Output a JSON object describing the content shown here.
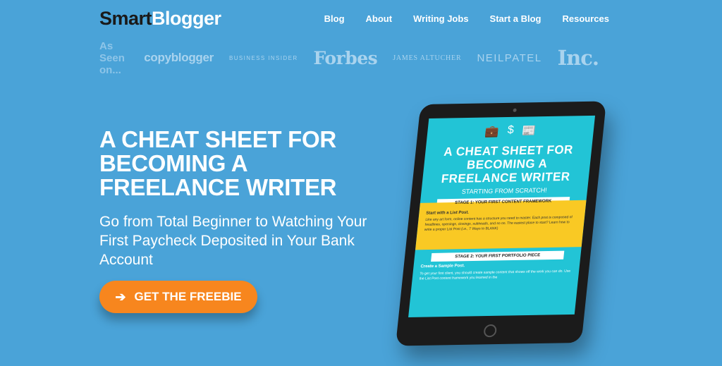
{
  "brand": {
    "part1": "Smart",
    "part2": "Blogger"
  },
  "nav": [
    {
      "label": "Blog"
    },
    {
      "label": "About"
    },
    {
      "label": "Writing Jobs"
    },
    {
      "label": "Start a Blog"
    },
    {
      "label": "Resources"
    }
  ],
  "seen": {
    "label": "As Seen on...",
    "logos": {
      "copyblogger": "copyblogger",
      "business_insider": "BUSINESS INSIDER",
      "forbes": "Forbes",
      "james": "JAMES ALTUCHER",
      "neilpatel": "NEILPATEL",
      "inc": "Inc."
    }
  },
  "hero": {
    "headline": "A CHEAT SHEET FOR BECOMING A FREELANCE WRITER",
    "subheadline": "Go from Total Beginner to Watching Your First Paycheck Deposited in Your Bank Account",
    "cta_label": "GET THE FREEBIE",
    "cta_icon": "arrow-right-icon"
  },
  "tablet": {
    "icons": [
      "briefcase-icon",
      "dollar-icon",
      "newspaper-icon"
    ],
    "title": "A CHEAT SHEET FOR BECOMING A FREELANCE WRITER",
    "subtitle": "STARTING FROM SCRATCH!",
    "stage1": "STAGE 1: YOUR FIRST CONTENT FRAMEWORK",
    "stage1_heading": "Start with a List Post.",
    "stage1_text": "Like any art form, online content has a structure you need to master. Each post is composed of headlines, openings, closings, subheads, and so on. The easiest place to start? Learn how to write a proper List Post (i.e., 7 Ways to BLANK)",
    "stage2": "STAGE 2: YOUR FIRST PORTFOLIO PIECE",
    "stage2_heading": "Create a Sample Post.",
    "stage2_text": "To get your first client, you should create sample content that shows off the work you can do. Use the List Post content framework you learned in the"
  },
  "colors": {
    "background": "#4aa3d8",
    "cta": "#f7861e",
    "tablet_screen": "#22c4d6",
    "tablet_band": "#f9c924"
  }
}
